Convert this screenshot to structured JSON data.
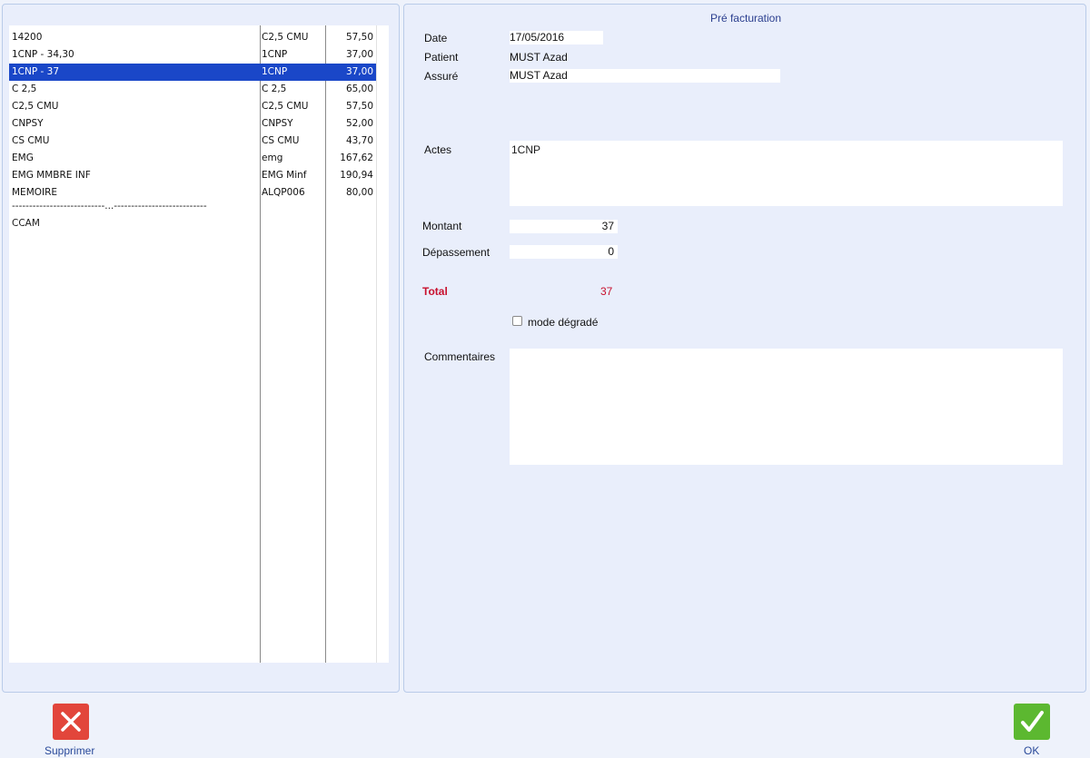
{
  "list": {
    "rows": [
      {
        "name": "14200",
        "code": "C2,5 CMU",
        "amount": "57,50",
        "selected": false
      },
      {
        "name": "1CNP - 34,30",
        "code": "1CNP",
        "amount": "37,00",
        "selected": false
      },
      {
        "name": "1CNP - 37",
        "code": "1CNP",
        "amount": "37,00",
        "selected": true
      },
      {
        "name": "C 2,5",
        "code": "C 2,5",
        "amount": "65,00",
        "selected": false
      },
      {
        "name": "C2,5 CMU",
        "code": "C2,5 CMU",
        "amount": "57,50",
        "selected": false
      },
      {
        "name": "CNPSY",
        "code": "CNPSY",
        "amount": "52,00",
        "selected": false
      },
      {
        "name": "CS CMU",
        "code": "CS CMU",
        "amount": "43,70",
        "selected": false
      },
      {
        "name": "EMG",
        "code": "emg",
        "amount": "167,62",
        "selected": false
      },
      {
        "name": "EMG MMBRE INF",
        "code": "EMG Minf",
        "amount": "190,94",
        "selected": false
      },
      {
        "name": "MEMOIRE",
        "code": "ALQP006",
        "amount": "80,00",
        "selected": false
      }
    ],
    "separator": "---------------------------...---------------------------",
    "tail": "CCAM"
  },
  "form": {
    "title": "Pré facturation",
    "date_label": "Date",
    "date_value": "17/05/2016",
    "patient_label": "Patient",
    "patient_value": "MUST Azad",
    "assure_label": "Assuré",
    "assure_value": "MUST Azad",
    "actes_label": "Actes",
    "actes_value": "1CNP",
    "montant_label": "Montant",
    "montant_value": "37",
    "depassement_label": "Dépassement",
    "depassement_value": "0",
    "total_label": "Total",
    "total_value": "37",
    "mode_label": "mode dégradé",
    "mode_checked": false,
    "commentaires_label": "Commentaires",
    "commentaires_value": ""
  },
  "buttons": {
    "delete_label": "Supprimer",
    "ok_label": "OK",
    "delete_icon": "close-icon",
    "ok_icon": "check-icon",
    "delete_color": "#e2463b",
    "ok_color": "#5cb830"
  }
}
